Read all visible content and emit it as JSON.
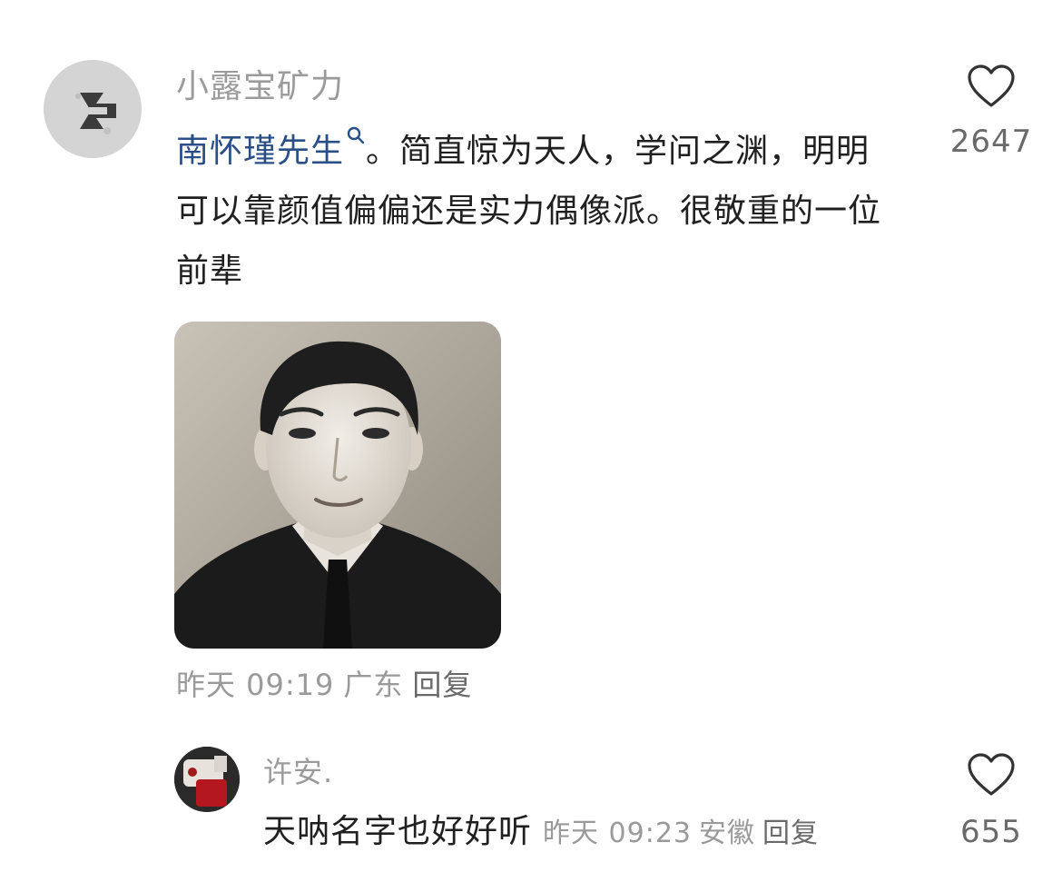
{
  "main_comment": {
    "username": "小露宝矿力",
    "mention": "南怀瑾先生",
    "text": "。简直惊为天人，学问之渊，明明可以靠颜值偏偏还是实力偶像派。很敬重的一位前辈",
    "likes": "2647",
    "time": "昨天 09:19",
    "location": "广东",
    "reply_label": "回复"
  },
  "reply_comment": {
    "username": "许安.",
    "text": "天呐名字也好好听",
    "time": "昨天 09:23",
    "location": "安徽",
    "reply_label": "回复",
    "likes": "655"
  },
  "colors": {
    "mention": "#2a4f86",
    "muted": "#9b9b9b",
    "text": "#202020"
  },
  "icons": {
    "like": "heart-icon",
    "mention_search": "search-icon"
  }
}
